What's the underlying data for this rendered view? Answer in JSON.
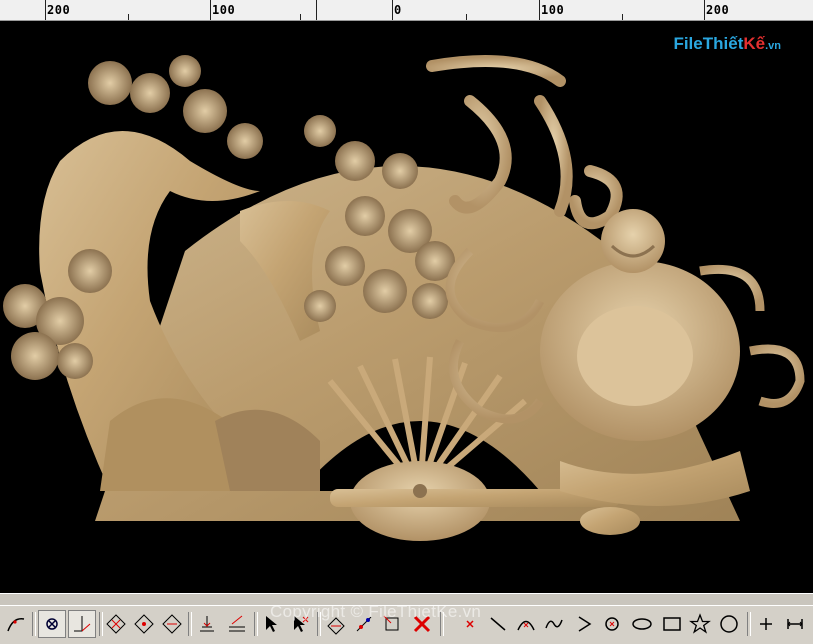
{
  "ruler": {
    "labels": [
      "200",
      "100",
      "0",
      "100",
      "200"
    ]
  },
  "watermark": {
    "part1": "File",
    "part2": "Thiết",
    "part3": "Kế",
    "part4": ".vn"
  },
  "copyright": "Copyright © FileThietKe.vn",
  "colors": {
    "background": "#000000",
    "wood": "#c9a97a",
    "toolbar": "#d4d0c8"
  },
  "toolbar": {
    "icons": [
      "curve-tool-icon",
      "snap-grid-icon",
      "axis-pick-icon",
      "node-diamond-icon",
      "node-diamond-2-icon",
      "node-diamond-3-icon",
      "align-icon",
      "distribute-icon",
      "select-arrow-icon",
      "select-node-icon",
      "transform-icon",
      "edit-node-icon",
      "trim-icon",
      "delete-icon",
      "cross-point-icon",
      "line-icon",
      "arc-icon",
      "spline-icon",
      "polygon-open-icon",
      "circle-center-icon",
      "ellipse-icon",
      "rectangle-icon",
      "star-icon",
      "hexagon-icon",
      "cross-icon",
      "dimension-icon"
    ]
  }
}
